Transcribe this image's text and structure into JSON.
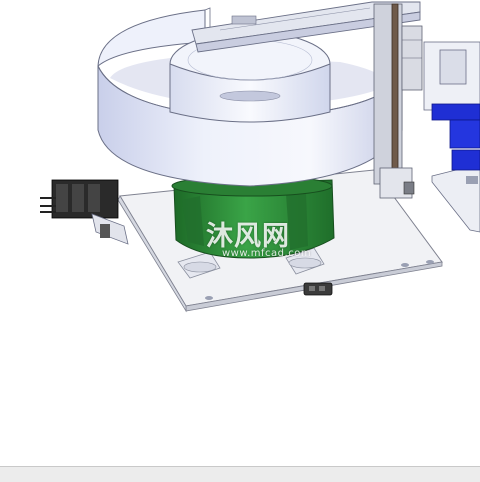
{
  "app": {
    "view": "cad-3d-viewport"
  },
  "model": {
    "name": "vibratory bowl feeder assembly"
  },
  "colors": {
    "bowl_body": "#2f8d3a",
    "bowl_rim": "#dfe5f7",
    "base_plate": "#f2f3f6",
    "fixture_blue": "#1f2fd4",
    "frame_brown": "#6f5a4a",
    "connector_black": "#222222"
  },
  "watermark": {
    "text_cn": "沐风网",
    "url": "www.mfcad.com"
  },
  "status_bar": {
    "text": ""
  }
}
